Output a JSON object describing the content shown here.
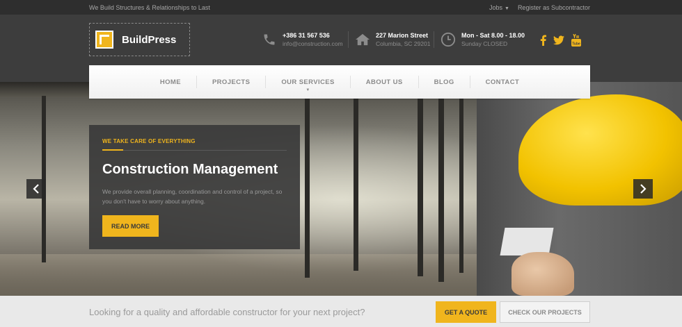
{
  "topbar": {
    "tagline": "We Build Structures & Relationships to Last",
    "jobs_label": "Jobs",
    "register_label": "Register as Subcontractor"
  },
  "header": {
    "logo_text": "BuildPress",
    "phone": {
      "icon": "phone-icon",
      "line1": "+386 31 567 536",
      "line2": "info@construction.com"
    },
    "address": {
      "icon": "home-icon",
      "line1": "227 Marion Street",
      "line2": "Columbia, SC 29201"
    },
    "hours": {
      "icon": "clock-icon",
      "line1": "Mon - Sat 8.00 - 18.00",
      "line2": "Sunday CLOSED"
    },
    "social": [
      "facebook-icon",
      "twitter-icon",
      "youtube-icon"
    ]
  },
  "nav": {
    "items": [
      "HOME",
      "PROJECTS",
      "OUR SERVICES",
      "ABOUT US",
      "BLOG",
      "CONTACT"
    ]
  },
  "slide": {
    "kicker": "WE TAKE CARE OF EVERYTHING",
    "title": "Construction Management",
    "text": "We provide overall planning, coordination and control of a project, so you don't have to worry about anything.",
    "button": "READ MORE"
  },
  "cta": {
    "text": "Looking for a quality and affordable constructor for your next project?",
    "quote_button": "GET A QUOTE",
    "projects_button": "CHECK OUR PROJECTS"
  },
  "colors": {
    "accent": "#f0b51d",
    "dark": "#3d3d3d",
    "topbar": "#2e2e2e"
  }
}
